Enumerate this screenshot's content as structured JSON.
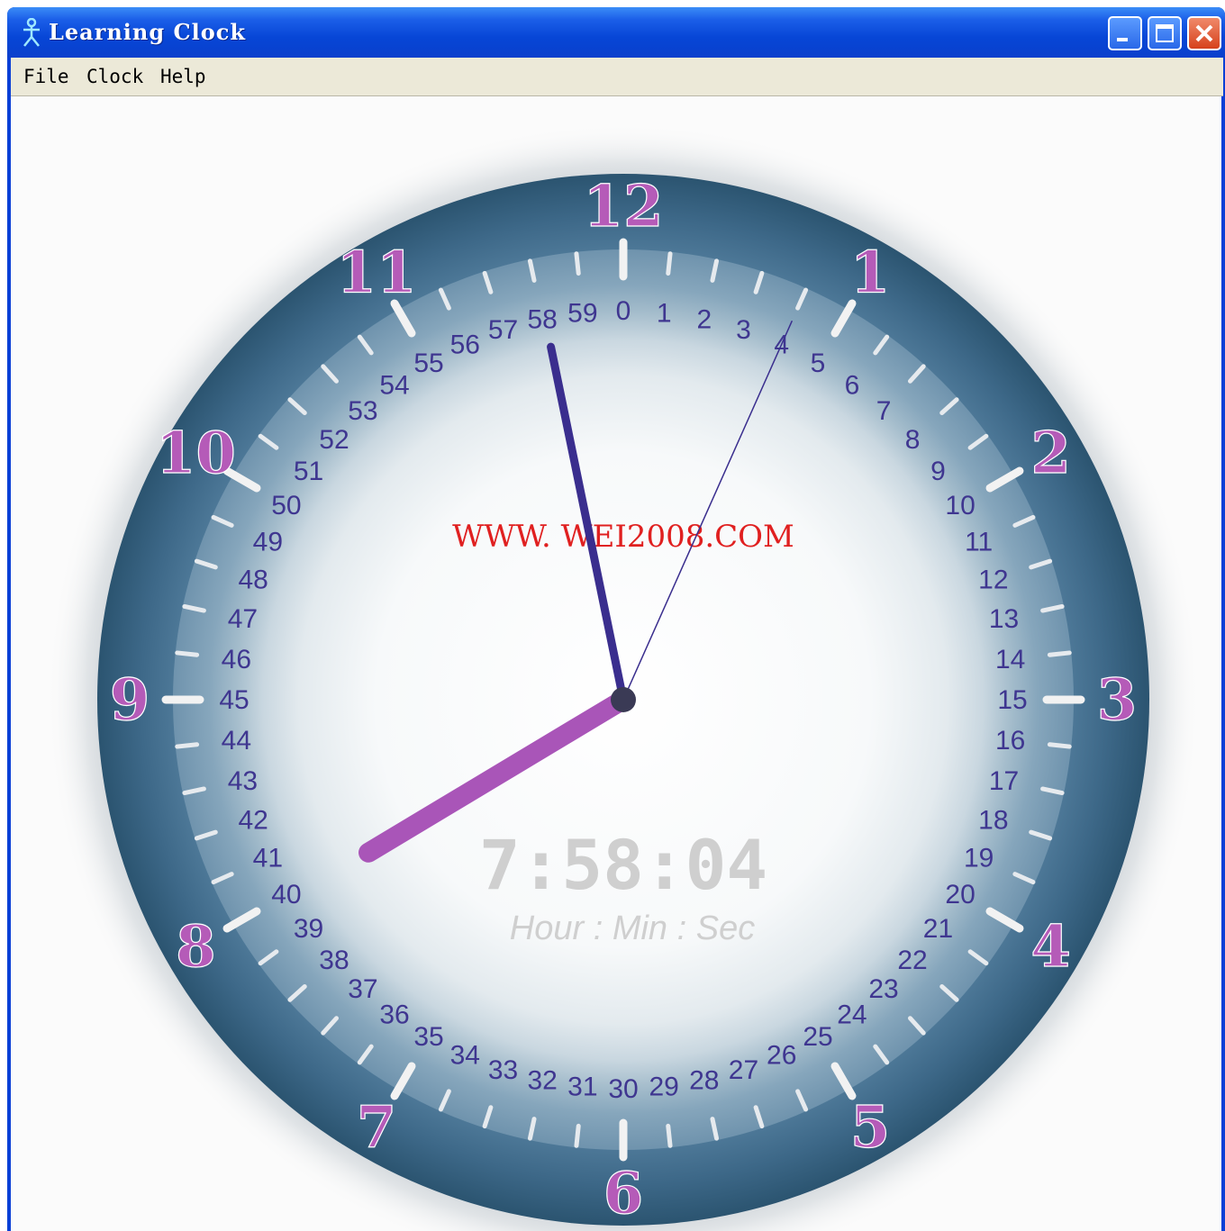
{
  "window": {
    "title": "Learning Clock",
    "icon": "stick-figure-icon"
  },
  "menu": [
    "File",
    "Clock",
    "Help"
  ],
  "clock": {
    "hour_numerals": [
      "12",
      "1",
      "2",
      "3",
      "4",
      "5",
      "6",
      "7",
      "8",
      "9",
      "10",
      "11"
    ],
    "minute_numerals": [
      "0",
      "1",
      "2",
      "3",
      "4",
      "5",
      "6",
      "7",
      "8",
      "9",
      "10",
      "11",
      "12",
      "13",
      "14",
      "15",
      "16",
      "17",
      "18",
      "19",
      "20",
      "21",
      "22",
      "23",
      "24",
      "25",
      "26",
      "27",
      "28",
      "29",
      "30",
      "31",
      "32",
      "33",
      "34",
      "35",
      "36",
      "37",
      "38",
      "39",
      "40",
      "41",
      "42",
      "43",
      "44",
      "45",
      "46",
      "47",
      "48",
      "49",
      "50",
      "51",
      "52",
      "53",
      "54",
      "55",
      "56",
      "57",
      "58",
      "59"
    ],
    "watermark": "WWW. WEI2008.COM",
    "digital_time": "7:58:04",
    "digital_caption": "Hour : Min  : Sec",
    "time": {
      "hour": 7,
      "minute": 58,
      "second": 4
    }
  },
  "colors": {
    "hour_numeral": "#b55bb8",
    "minute_numeral": "#3f3690",
    "hour_hand": "#a955b8",
    "minute_hand": "#3a2e8e",
    "second_hand": "#3a2e8e",
    "watermark": "#e02020",
    "digital": "#cfcfcf"
  }
}
